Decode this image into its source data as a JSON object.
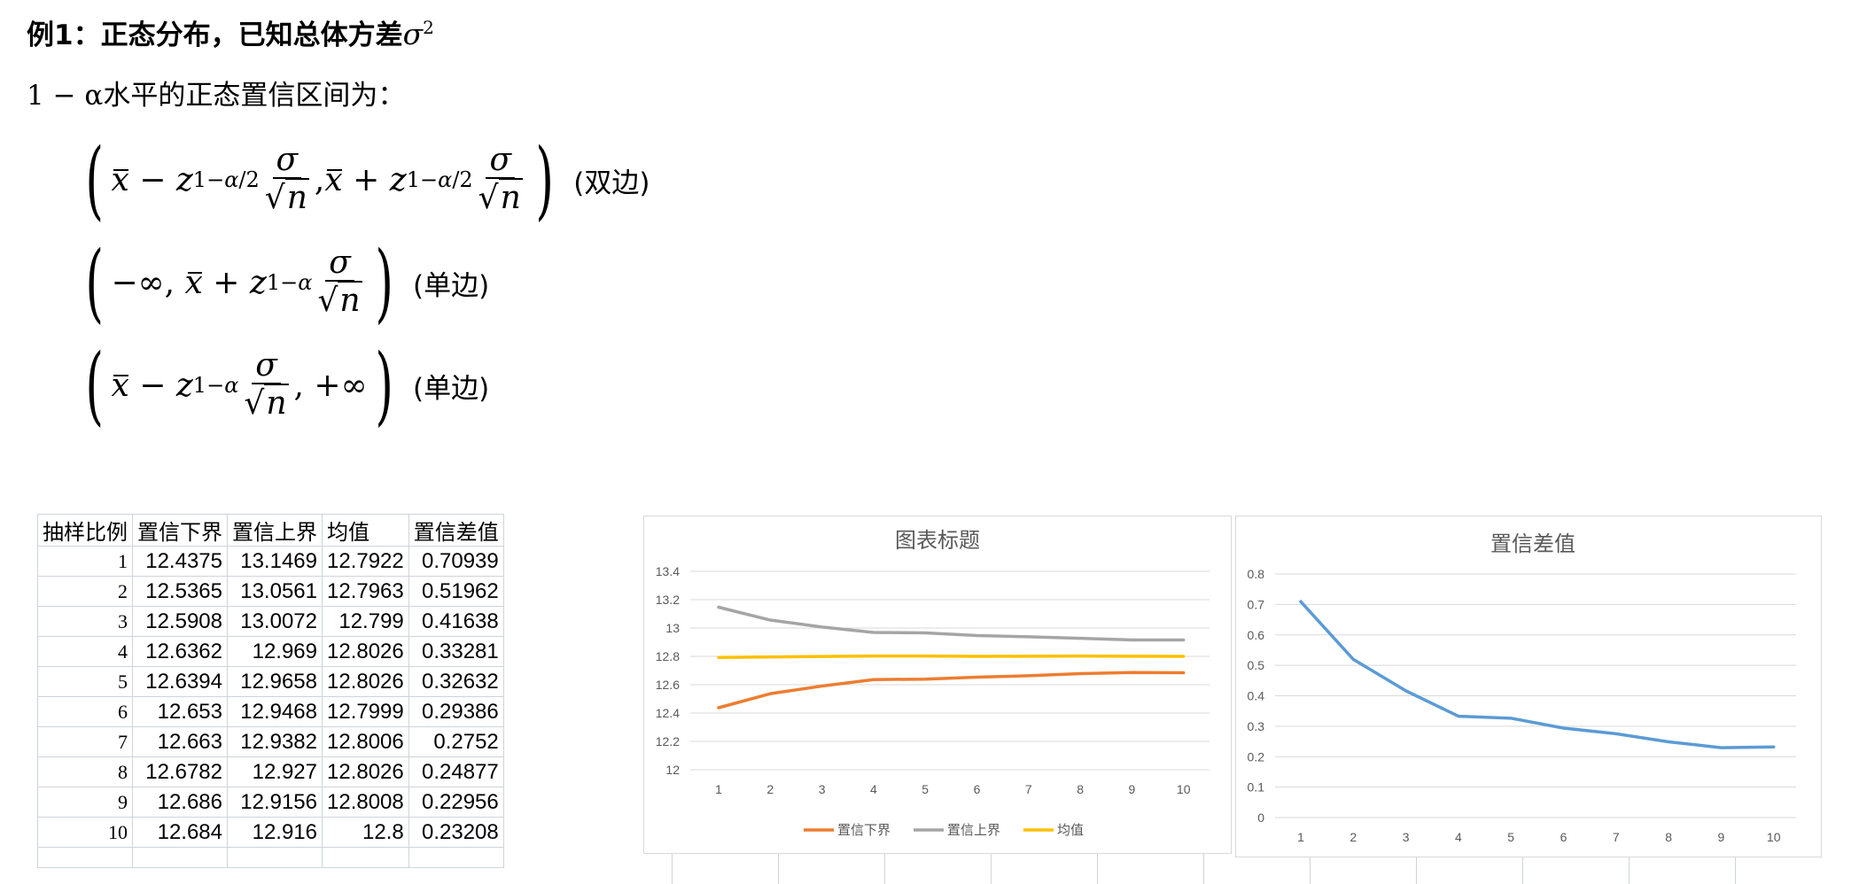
{
  "heading": {
    "text": "例1：正态分布，已知总体方差",
    "sigma": "σ",
    "exp": "2"
  },
  "intro": {
    "math": "1 − α",
    "text": "水平的正态置信区间为："
  },
  "formulas": {
    "two_sided_note": "(双边)",
    "one_sided_note": "(单边)"
  },
  "table": {
    "headers": [
      "抽样比例",
      "置信下界",
      "置信上界",
      "均值",
      "置信差值"
    ],
    "rows": [
      [
        "1",
        "12.4375",
        "13.1469",
        "12.7922",
        "0.70939"
      ],
      [
        "2",
        "12.5365",
        "13.0561",
        "12.7963",
        "0.51962"
      ],
      [
        "3",
        "12.5908",
        "13.0072",
        "12.799",
        "0.41638"
      ],
      [
        "4",
        "12.6362",
        "12.969",
        "12.8026",
        "0.33281"
      ],
      [
        "5",
        "12.6394",
        "12.9658",
        "12.8026",
        "0.32632"
      ],
      [
        "6",
        "12.653",
        "12.9468",
        "12.7999",
        "0.29386"
      ],
      [
        "7",
        "12.663",
        "12.9382",
        "12.8006",
        "0.2752"
      ],
      [
        "8",
        "12.6782",
        "12.927",
        "12.8026",
        "0.24877"
      ],
      [
        "9",
        "12.686",
        "12.9156",
        "12.8008",
        "0.22956"
      ],
      [
        "10",
        "12.684",
        "12.916",
        "12.8",
        "0.23208"
      ]
    ]
  },
  "chart_data": [
    {
      "type": "line",
      "title": "图表标题",
      "x": [
        "1",
        "2",
        "3",
        "4",
        "5",
        "6",
        "7",
        "8",
        "9",
        "10"
      ],
      "ylim": [
        12,
        13.4
      ],
      "yticks": [
        "12",
        "12.2",
        "12.4",
        "12.6",
        "12.8",
        "13",
        "13.2",
        "13.4"
      ],
      "grid": true,
      "legend": "bottom",
      "series": [
        {
          "name": "置信下界",
          "color": "#ED7D31",
          "values": [
            12.4375,
            12.5365,
            12.5908,
            12.6362,
            12.6394,
            12.653,
            12.663,
            12.6782,
            12.686,
            12.684
          ]
        },
        {
          "name": "置信上界",
          "color": "#A5A5A5",
          "values": [
            13.1469,
            13.0561,
            13.0072,
            12.969,
            12.9658,
            12.9468,
            12.9382,
            12.927,
            12.9156,
            12.916
          ]
        },
        {
          "name": "均值",
          "color": "#FFC000",
          "values": [
            12.7922,
            12.7963,
            12.799,
            12.8026,
            12.8026,
            12.7999,
            12.8006,
            12.8026,
            12.8008,
            12.8
          ]
        }
      ]
    },
    {
      "type": "line",
      "title": "置信差值",
      "x": [
        "1",
        "2",
        "3",
        "4",
        "5",
        "6",
        "7",
        "8",
        "9",
        "10"
      ],
      "ylim": [
        0,
        0.8
      ],
      "yticks": [
        "0",
        "0.1",
        "0.2",
        "0.3",
        "0.4",
        "0.5",
        "0.6",
        "0.7",
        "0.8"
      ],
      "grid": true,
      "series": [
        {
          "color": "#5B9BD5",
          "values": [
            0.70939,
            0.51962,
            0.41638,
            0.33281,
            0.32632,
            0.29386,
            0.2752,
            0.24877,
            0.22956,
            0.23208
          ]
        }
      ]
    }
  ]
}
